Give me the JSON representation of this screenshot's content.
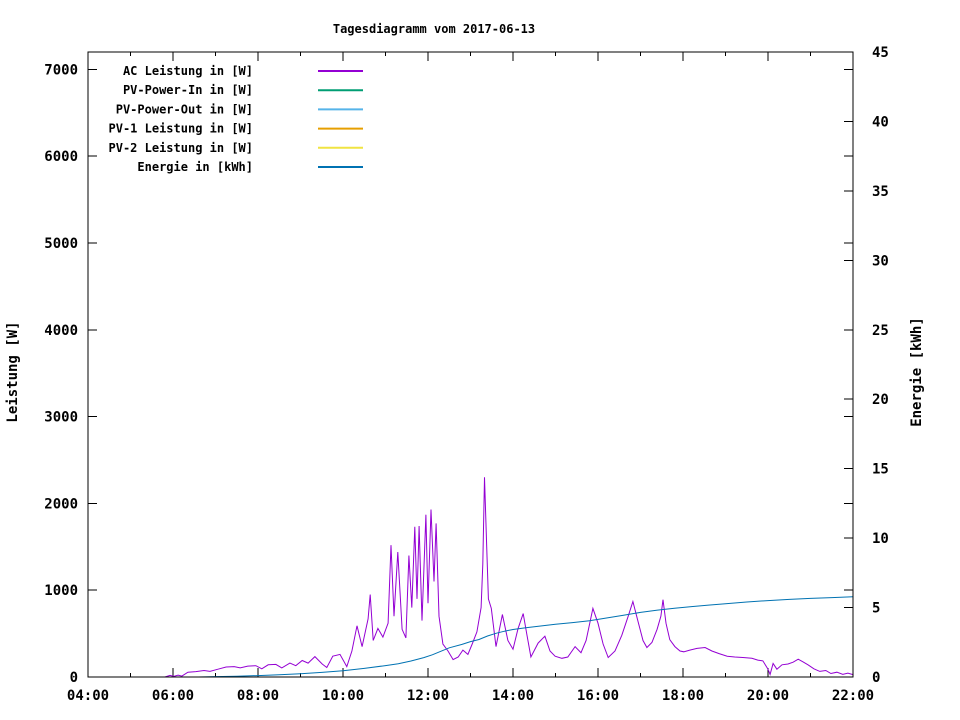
{
  "title": "Tagesdiagramm vom 2017-06-13",
  "legend": {
    "items": [
      {
        "label": "AC Leistung in [W]",
        "color": "#9400d3"
      },
      {
        "label": "PV-Power-In in [W]",
        "color": "#009e73"
      },
      {
        "label": "PV-Power-Out in [W]",
        "color": "#56b4e9"
      },
      {
        "label": "PV-1 Leistung in [W]",
        "color": "#e69f00"
      },
      {
        "label": "PV-2 Leistung in [W]",
        "color": "#f0e442"
      },
      {
        "label": "Energie in [kWh]",
        "color": "#0072b2"
      }
    ]
  },
  "chart_data": {
    "type": "line",
    "title": "Tagesdiagramm vom 2017-06-13",
    "background": "#ffffff",
    "border_color": "#000000",
    "grid": false,
    "legend_position": "top-left-inside",
    "x_axis": {
      "range_hours": [
        4,
        22
      ],
      "major_tick_labels": [
        "04:00",
        "06:00",
        "08:00",
        "10:00",
        "12:00",
        "14:00",
        "16:00",
        "18:00",
        "20:00",
        "22:00"
      ],
      "major_tick_hours": [
        4,
        6,
        8,
        10,
        12,
        14,
        16,
        18,
        20,
        22
      ],
      "minor_tick_hours": [
        5,
        7,
        9,
        11,
        13,
        15,
        17,
        19,
        21
      ]
    },
    "y_left": {
      "label": "Leistung [W]",
      "range": [
        0,
        7200
      ],
      "tick_values": [
        0,
        1000,
        2000,
        3000,
        4000,
        5000,
        6000,
        7000
      ],
      "tick_labels": [
        "0",
        "1000",
        "2000",
        "3000",
        "4000",
        "5000",
        "6000",
        "7000"
      ]
    },
    "y_right": {
      "label": "Energie [kWh]",
      "range": [
        0,
        45
      ],
      "tick_values": [
        0,
        5,
        10,
        15,
        20,
        25,
        30,
        35,
        40,
        45
      ],
      "tick_labels": [
        "0",
        "5",
        "10",
        "15",
        "20",
        "25",
        "30",
        "35",
        "40",
        "45"
      ]
    },
    "series": [
      {
        "name": "AC Leistung in [W]",
        "color": "#9400d3",
        "axis": "left",
        "visible": true,
        "points": [
          [
            5.81,
            0
          ],
          [
            5.93,
            18
          ],
          [
            6.02,
            8
          ],
          [
            6.12,
            22
          ],
          [
            6.21,
            10
          ],
          [
            6.35,
            55
          ],
          [
            6.54,
            62
          ],
          [
            6.73,
            75
          ],
          [
            6.87,
            65
          ],
          [
            7.06,
            90
          ],
          [
            7.25,
            115
          ],
          [
            7.44,
            120
          ],
          [
            7.58,
            105
          ],
          [
            7.76,
            125
          ],
          [
            7.95,
            130
          ],
          [
            8.09,
            95
          ],
          [
            8.24,
            140
          ],
          [
            8.42,
            145
          ],
          [
            8.56,
            105
          ],
          [
            8.75,
            160
          ],
          [
            8.89,
            130
          ],
          [
            9.04,
            190
          ],
          [
            9.18,
            160
          ],
          [
            9.34,
            235
          ],
          [
            9.51,
            150
          ],
          [
            9.62,
            110
          ],
          [
            9.76,
            240
          ],
          [
            9.93,
            260
          ],
          [
            10.09,
            120
          ],
          [
            10.21,
            300
          ],
          [
            10.33,
            590
          ],
          [
            10.45,
            350
          ],
          [
            10.59,
            670
          ],
          [
            10.64,
            950
          ],
          [
            10.71,
            420
          ],
          [
            10.82,
            560
          ],
          [
            10.94,
            460
          ],
          [
            11.06,
            620
          ],
          [
            11.13,
            1520
          ],
          [
            11.2,
            700
          ],
          [
            11.29,
            1440
          ],
          [
            11.39,
            550
          ],
          [
            11.48,
            450
          ],
          [
            11.55,
            1400
          ],
          [
            11.62,
            800
          ],
          [
            11.69,
            1730
          ],
          [
            11.74,
            900
          ],
          [
            11.79,
            1740
          ],
          [
            11.86,
            650
          ],
          [
            11.95,
            1870
          ],
          [
            12.0,
            850
          ],
          [
            12.07,
            1930
          ],
          [
            12.14,
            1100
          ],
          [
            12.19,
            1770
          ],
          [
            12.26,
            700
          ],
          [
            12.35,
            380
          ],
          [
            12.47,
            300
          ],
          [
            12.59,
            200
          ],
          [
            12.71,
            230
          ],
          [
            12.82,
            310
          ],
          [
            12.94,
            260
          ],
          [
            13.04,
            380
          ],
          [
            13.15,
            520
          ],
          [
            13.25,
            800
          ],
          [
            13.29,
            1300
          ],
          [
            13.33,
            2300
          ],
          [
            13.38,
            1500
          ],
          [
            13.42,
            900
          ],
          [
            13.49,
            790
          ],
          [
            13.6,
            350
          ],
          [
            13.75,
            720
          ],
          [
            13.88,
            420
          ],
          [
            14.0,
            320
          ],
          [
            14.12,
            560
          ],
          [
            14.24,
            730
          ],
          [
            14.33,
            480
          ],
          [
            14.42,
            230
          ],
          [
            14.59,
            390
          ],
          [
            14.75,
            470
          ],
          [
            14.87,
            300
          ],
          [
            14.99,
            240
          ],
          [
            15.15,
            215
          ],
          [
            15.29,
            230
          ],
          [
            15.46,
            350
          ],
          [
            15.6,
            280
          ],
          [
            15.72,
            420
          ],
          [
            15.88,
            790
          ],
          [
            16.0,
            620
          ],
          [
            16.12,
            380
          ],
          [
            16.24,
            225
          ],
          [
            16.4,
            300
          ],
          [
            16.56,
            480
          ],
          [
            16.71,
            700
          ],
          [
            16.82,
            870
          ],
          [
            16.94,
            640
          ],
          [
            17.06,
            420
          ],
          [
            17.15,
            340
          ],
          [
            17.27,
            400
          ],
          [
            17.39,
            550
          ],
          [
            17.48,
            700
          ],
          [
            17.53,
            890
          ],
          [
            17.6,
            620
          ],
          [
            17.69,
            430
          ],
          [
            17.81,
            350
          ],
          [
            17.93,
            300
          ],
          [
            18.02,
            290
          ],
          [
            18.16,
            310
          ],
          [
            18.33,
            330
          ],
          [
            18.52,
            340
          ],
          [
            18.68,
            300
          ],
          [
            18.85,
            270
          ],
          [
            19.04,
            240
          ],
          [
            19.22,
            230
          ],
          [
            19.41,
            225
          ],
          [
            19.62,
            215
          ],
          [
            19.76,
            195
          ],
          [
            19.88,
            185
          ],
          [
            20.0,
            90
          ],
          [
            20.05,
            30
          ],
          [
            20.12,
            155
          ],
          [
            20.21,
            90
          ],
          [
            20.33,
            140
          ],
          [
            20.47,
            150
          ],
          [
            20.59,
            170
          ],
          [
            20.71,
            205
          ],
          [
            20.82,
            175
          ],
          [
            20.94,
            140
          ],
          [
            21.08,
            95
          ],
          [
            21.22,
            65
          ],
          [
            21.36,
            75
          ],
          [
            21.48,
            40
          ],
          [
            21.62,
            55
          ],
          [
            21.76,
            30
          ],
          [
            21.88,
            45
          ],
          [
            22.0,
            28
          ]
        ]
      },
      {
        "name": "PV-Power-In in [W]",
        "color": "#009e73",
        "axis": "left",
        "visible": false,
        "points": []
      },
      {
        "name": "PV-Power-Out in [W]",
        "color": "#56b4e9",
        "axis": "left",
        "visible": false,
        "points": []
      },
      {
        "name": "PV-1 Leistung in [W]",
        "color": "#e69f00",
        "axis": "left",
        "visible": false,
        "points": []
      },
      {
        "name": "PV-2 Leistung in [W]",
        "color": "#f0e442",
        "axis": "left",
        "visible": false,
        "points": []
      },
      {
        "name": "Energie in [kWh]",
        "color": "#0072b2",
        "axis": "right",
        "visible": true,
        "points": [
          [
            6.6,
            0
          ],
          [
            7.0,
            0.03
          ],
          [
            7.5,
            0.06
          ],
          [
            8.0,
            0.1
          ],
          [
            8.5,
            0.16
          ],
          [
            9.0,
            0.24
          ],
          [
            9.5,
            0.33
          ],
          [
            10.0,
            0.45
          ],
          [
            10.5,
            0.62
          ],
          [
            11.0,
            0.82
          ],
          [
            11.3,
            0.95
          ],
          [
            11.6,
            1.15
          ],
          [
            11.9,
            1.4
          ],
          [
            12.1,
            1.6
          ],
          [
            12.3,
            1.85
          ],
          [
            12.5,
            2.1
          ],
          [
            12.8,
            2.35
          ],
          [
            13.0,
            2.55
          ],
          [
            13.2,
            2.7
          ],
          [
            13.4,
            2.95
          ],
          [
            13.6,
            3.15
          ],
          [
            13.8,
            3.3
          ],
          [
            14.0,
            3.42
          ],
          [
            14.3,
            3.55
          ],
          [
            14.6,
            3.66
          ],
          [
            15.0,
            3.8
          ],
          [
            15.4,
            3.92
          ],
          [
            15.8,
            4.05
          ],
          [
            16.2,
            4.25
          ],
          [
            16.6,
            4.45
          ],
          [
            17.0,
            4.65
          ],
          [
            17.4,
            4.82
          ],
          [
            17.8,
            4.95
          ],
          [
            18.2,
            5.07
          ],
          [
            18.6,
            5.18
          ],
          [
            19.0,
            5.27
          ],
          [
            19.5,
            5.4
          ],
          [
            20.0,
            5.5
          ],
          [
            20.5,
            5.59
          ],
          [
            21.0,
            5.66
          ],
          [
            21.5,
            5.72
          ],
          [
            22.0,
            5.78
          ]
        ]
      }
    ]
  }
}
